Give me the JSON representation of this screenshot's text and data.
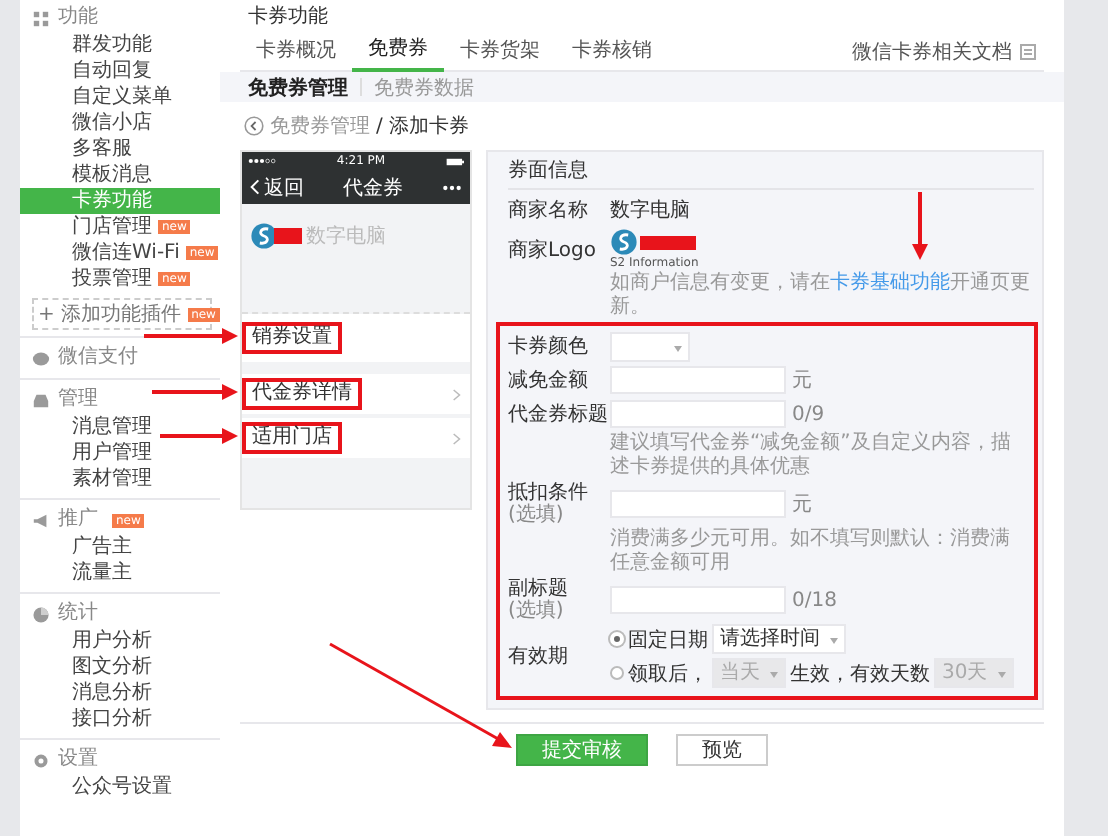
{
  "sidebar": {
    "groups": [
      {
        "title": "功能",
        "items": [
          {
            "label": "群发功能",
            "selected": false
          },
          {
            "label": "自动回复",
            "selected": false
          },
          {
            "label": "自定义菜单",
            "selected": false
          },
          {
            "label": "微信小店",
            "selected": false
          },
          {
            "label": "多客服",
            "selected": false
          },
          {
            "label": "模板消息",
            "selected": false
          },
          {
            "label": "卡券功能",
            "selected": true
          },
          {
            "label": "门店管理",
            "selected": false,
            "badge": "new"
          },
          {
            "label": "微信连Wi-Fi",
            "selected": false,
            "badge": "new"
          },
          {
            "label": "投票管理",
            "selected": false,
            "badge": "new"
          }
        ],
        "add_button": {
          "icon": "+",
          "label": "添加功能插件",
          "badge": "new"
        }
      },
      {
        "title": "微信支付"
      },
      {
        "title": "管理",
        "items": [
          {
            "label": "消息管理",
            "selected": false
          },
          {
            "label": "用户管理",
            "selected": false
          },
          {
            "label": "素材管理",
            "selected": false
          }
        ]
      },
      {
        "title": "推广",
        "badge": "new",
        "items": [
          {
            "label": "广告主",
            "selected": false
          },
          {
            "label": "流量主",
            "selected": false
          }
        ]
      },
      {
        "title": "统计",
        "items": [
          {
            "label": "用户分析",
            "selected": false
          },
          {
            "label": "图文分析",
            "selected": false
          },
          {
            "label": "消息分析",
            "selected": false
          },
          {
            "label": "接口分析",
            "selected": false
          }
        ]
      },
      {
        "title": "设置",
        "items": [
          {
            "label": "公众号设置",
            "selected": false
          }
        ]
      }
    ]
  },
  "page_title": "卡券功能",
  "tabs": [
    {
      "label": "卡券概况",
      "selected": false
    },
    {
      "label": "免费券",
      "selected": true
    },
    {
      "label": "卡券货架",
      "selected": false
    },
    {
      "label": "卡券核销",
      "selected": false
    }
  ],
  "doc_link": "微信卡券相关文档",
  "sub_tabs": [
    {
      "label": "免费券管理",
      "selected": true
    },
    {
      "label": "免费券数据",
      "selected": false
    }
  ],
  "breadcrumb": {
    "parent": "免费券管理",
    "separator": "/",
    "current": "添加卡券"
  },
  "phone": {
    "time": "4:21 PM",
    "back": "返回",
    "title": "代金券",
    "merchant": "数字电脑",
    "rows": [
      {
        "label": "销券设置",
        "chevron": false
      },
      {
        "label": "代金券详情",
        "chevron": true
      },
      {
        "label": "适用门店",
        "chevron": true
      }
    ]
  },
  "form": {
    "section": "券面信息",
    "merchant_name": {
      "label": "商家名称",
      "value": "数字电脑"
    },
    "logo": {
      "label": "商家Logo",
      "caption": "S2 Information"
    },
    "logo_hint": {
      "before": "如商户信息有变更，请在",
      "link": "卡券基础功能",
      "after": "开通页更新。"
    },
    "fields": [
      {
        "kind": "color",
        "label": "卡券颜色"
      },
      {
        "kind": "input",
        "label": "减免金额",
        "suffix": "元"
      },
      {
        "kind": "input",
        "label": "代金券标题",
        "suffix": "0/9",
        "hint": "建议填写代金券“减免金额”及自定义内容，描述卡券提供的具体优惠"
      },
      {
        "kind": "input",
        "label": "抵扣条件",
        "optional": "(选填)",
        "suffix": "元",
        "hint": "消费满多少元可用。如不填写则默认：消费满任意金额可用"
      },
      {
        "kind": "input",
        "label": "副标题",
        "optional": "(选填)",
        "suffix": "0/18"
      },
      {
        "kind": "validity",
        "label": "有效期",
        "options": [
          {
            "label": "固定日期",
            "selected": true,
            "select": "请选择时间"
          },
          {
            "label": "领取后，",
            "selected": false,
            "select": "当天",
            "middle": "生效，有效天数",
            "select2": "30天"
          }
        ]
      }
    ]
  },
  "buttons": [
    {
      "label": "提交审核",
      "kind": "primary"
    },
    {
      "label": "预览",
      "kind": "default"
    }
  ]
}
